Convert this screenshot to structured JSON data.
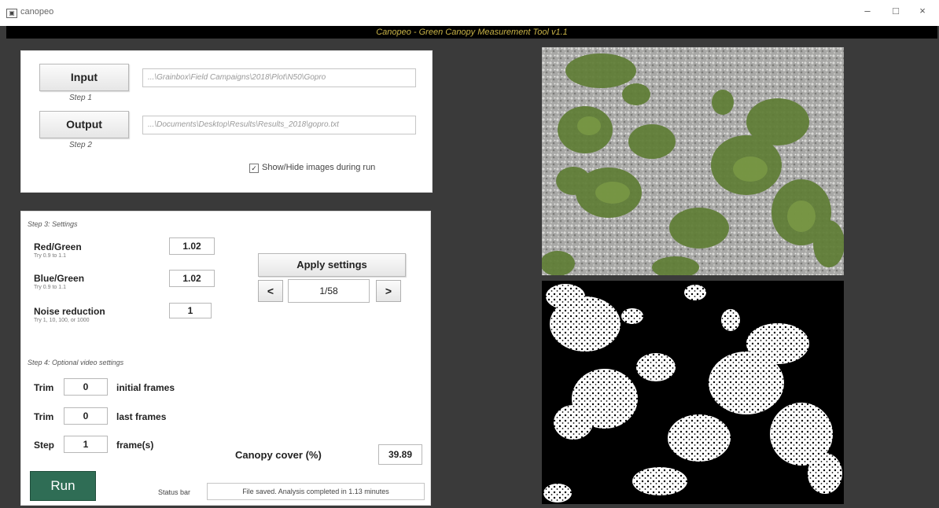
{
  "window": {
    "title": "canopeo",
    "icon": "app-icon",
    "minimize": "–",
    "maximize": "□",
    "close": "×"
  },
  "header": {
    "title": "Canopeo - Green Canopy Measurement Tool v1.1"
  },
  "io_panel": {
    "input_button": "Input",
    "input_step": "Step 1",
    "input_path": "...\\Grainbox\\Field Campaigns\\2018\\Plot\\N50\\Gopro",
    "output_button": "Output",
    "output_step": "Step 2",
    "output_path": "...\\Documents\\Desktop\\Results\\Results_2018\\gopro.txt",
    "show_hide_checked": true,
    "show_hide_label": "Show/Hide images during run"
  },
  "settings": {
    "section_label": "Step 3: Settings",
    "red_green": {
      "label": "Red/Green",
      "hint": "Try 0.9 to 1.1",
      "value": "1.02"
    },
    "blue_green": {
      "label": "Blue/Green",
      "hint": "Try 0.9 to 1.1",
      "value": "1.02"
    },
    "noise": {
      "label": "Noise reduction",
      "hint": "Try 1, 10, 100, or 1000",
      "value": "1"
    },
    "apply_button": "Apply settings",
    "prev_button": "<",
    "next_button": ">",
    "frame_counter": "1/58"
  },
  "video": {
    "section_label": "Step 4: Optional video settings",
    "trim_initial": {
      "label": "Trim",
      "value": "0",
      "suffix": "initial frames"
    },
    "trim_last": {
      "label": "Trim",
      "value": "0",
      "suffix": "last frames"
    },
    "step": {
      "label": "Step",
      "value": "1",
      "suffix": "frame(s)"
    }
  },
  "result": {
    "label": "Canopy cover (%)",
    "value": "39.89"
  },
  "run_button": "Run",
  "status": {
    "label": "Status bar",
    "text": "File saved. Analysis completed in 1.13 minutes"
  },
  "colors": {
    "run_button": "#2f6d55",
    "header_text": "#c9b347",
    "background": "#3a3a3a"
  },
  "images": {
    "original": "field-photo",
    "classified": "binary-canopy-mask"
  }
}
